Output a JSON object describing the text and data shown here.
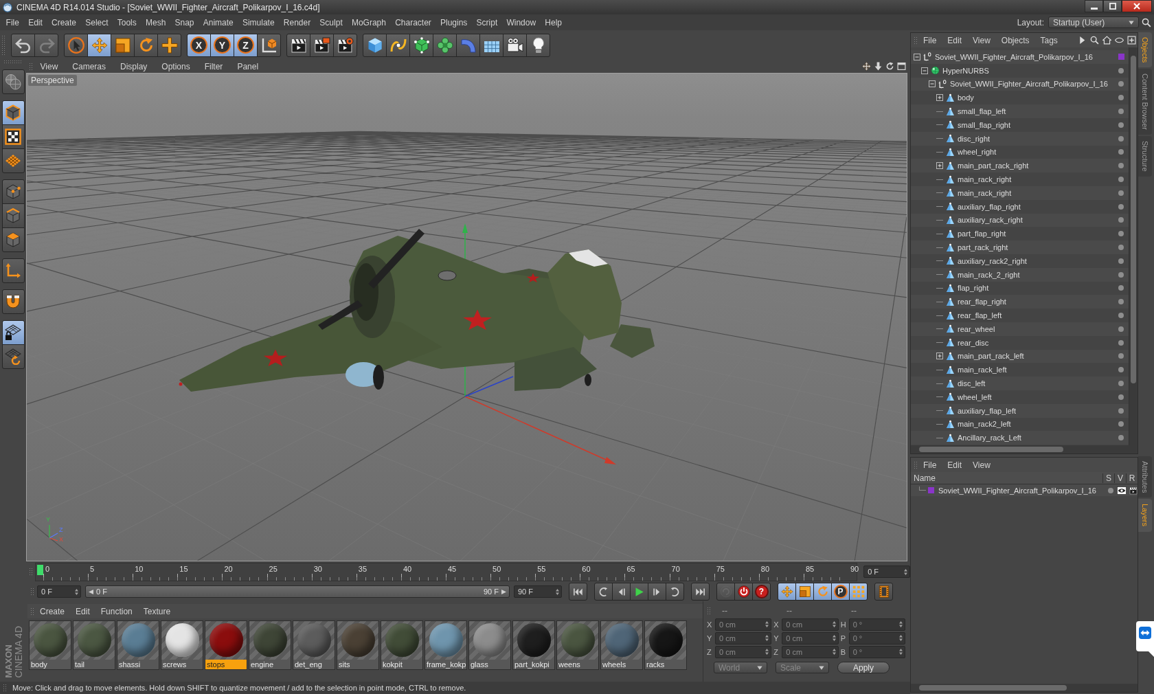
{
  "window": {
    "title": "CINEMA 4D R14.014 Studio - [Soviet_WWII_Fighter_Aircraft_Polikarpov_I_16.c4d]"
  },
  "menu": [
    "File",
    "Edit",
    "Create",
    "Select",
    "Tools",
    "Mesh",
    "Snap",
    "Animate",
    "Simulate",
    "Render",
    "Sculpt",
    "MoGraph",
    "Character",
    "Plugins",
    "Script",
    "Window",
    "Help"
  ],
  "layout": {
    "label": "Layout:",
    "value": "Startup (User)"
  },
  "toolbar": [
    [
      {
        "kind": "undo",
        "disabled": false
      },
      {
        "kind": "redo",
        "disabled": true
      }
    ],
    [
      {
        "kind": "select",
        "selected": false
      },
      {
        "kind": "move",
        "selected": true
      },
      {
        "kind": "scale",
        "selected": false
      },
      {
        "kind": "rotate",
        "selected": false
      },
      {
        "kind": "recent-tool",
        "selected": false
      }
    ],
    [
      {
        "kind": "axis-lock",
        "label": "X",
        "selected": true
      },
      {
        "kind": "axis-lock",
        "label": "Y",
        "selected": true
      },
      {
        "kind": "axis-lock",
        "label": "Z",
        "selected": true
      },
      {
        "kind": "coordinate-system",
        "selected": false
      }
    ],
    [
      {
        "kind": "render-view"
      },
      {
        "kind": "render-picture"
      },
      {
        "kind": "render-settings"
      }
    ],
    [
      {
        "kind": "cube"
      },
      {
        "kind": "spline"
      },
      {
        "kind": "nurbs"
      },
      {
        "kind": "cloner"
      },
      {
        "kind": "deformer"
      },
      {
        "kind": "floor"
      },
      {
        "kind": "camera"
      },
      {
        "kind": "light"
      }
    ]
  ],
  "left_tools": [
    [
      {
        "kind": "convert",
        "selected": false
      }
    ],
    [
      {
        "kind": "model",
        "selected": true
      },
      {
        "kind": "texture",
        "selected": false
      },
      {
        "kind": "workplane",
        "selected": false
      }
    ],
    [
      {
        "kind": "points",
        "selected": false
      },
      {
        "kind": "edges",
        "selected": false
      },
      {
        "kind": "polygons",
        "selected": false
      }
    ],
    [
      {
        "kind": "axis",
        "selected": false
      }
    ],
    [
      {
        "kind": "magnet",
        "selected": false
      }
    ],
    [
      {
        "kind": "lock-workplane",
        "selected": true
      },
      {
        "kind": "workplane-rotate",
        "selected": false
      }
    ]
  ],
  "viewport": {
    "menu": [
      "View",
      "Cameras",
      "Display",
      "Options",
      "Filter",
      "Panel"
    ],
    "name": "Perspective",
    "axis_labels": [
      "Y",
      "Z",
      "X"
    ]
  },
  "timeline": {
    "ticks": [
      "0",
      "5",
      "10",
      "15",
      "20",
      "25",
      "30",
      "35",
      "40",
      "45",
      "50",
      "55",
      "60",
      "65",
      "70",
      "75",
      "80",
      "85",
      "90"
    ],
    "level": 0,
    "current": "0 F"
  },
  "playback": {
    "start": "0 F",
    "range": {
      "start": "0 F",
      "end": "90 F",
      "level": 1
    },
    "end": "90 F",
    "transport": [
      [
        {
          "kind": "go-to-start"
        }
      ],
      [
        {
          "kind": "previous-key"
        },
        {
          "kind": "previous-frame"
        },
        {
          "kind": "play"
        },
        {
          "kind": "next-frame"
        },
        {
          "kind": "next-key"
        }
      ],
      [
        {
          "kind": "go-to-end"
        }
      ]
    ],
    "record": [
      {
        "kind": "autokey",
        "disabled": true
      },
      {
        "kind": "record",
        "disabled": false
      },
      {
        "kind": "key-selection",
        "label": "?",
        "disabled": false
      }
    ],
    "key_modes": [
      {
        "kind": "key-position",
        "selected": true
      },
      {
        "kind": "key-scale",
        "selected": true
      },
      {
        "kind": "key-rotation",
        "selected": true
      },
      {
        "kind": "key-parameter",
        "label": "P",
        "selected": true
      },
      {
        "kind": "key-pla",
        "selected": true
      }
    ]
  },
  "materials": {
    "menu": [
      "Create",
      "Edit",
      "Function",
      "Texture"
    ],
    "items": [
      {
        "name": "body",
        "color": "#4a5540",
        "selected": false
      },
      {
        "name": "tail",
        "color": "#4b5742",
        "selected": false
      },
      {
        "name": "shassi",
        "color": "#5a7d94",
        "selected": false
      },
      {
        "name": "screws",
        "color": "#e4e4e4",
        "selected": false
      },
      {
        "name": "stops",
        "color": "#8b0d0d",
        "selected": true
      },
      {
        "name": "engine",
        "color": "#3e4536",
        "selected": false
      },
      {
        "name": "det_eng",
        "color": "#5c5c5c",
        "selected": false
      },
      {
        "name": "sits",
        "color": "#4a4034",
        "selected": false
      },
      {
        "name": "kokpit",
        "color": "#414c37",
        "selected": false
      },
      {
        "name": "frame_kokp",
        "color": "#6f95ad",
        "selected": false
      },
      {
        "name": "glass",
        "color": "#8c8c8c",
        "selected": false
      },
      {
        "name": "part_kokpi",
        "color": "#1e1e1e",
        "selected": false
      },
      {
        "name": "weens",
        "color": "#4a5540",
        "selected": false
      },
      {
        "name": "wheels",
        "color": "#4f6577",
        "selected": false
      },
      {
        "name": "racks",
        "color": "#161616",
        "selected": false
      }
    ]
  },
  "coordinates": {
    "headers": [
      "--",
      "--",
      "--"
    ],
    "rows": [
      {
        "pos_axis": "X",
        "pos": "0 cm",
        "size_axis": "X",
        "size": "0 cm",
        "rot_axis": "H",
        "rot": "0 °"
      },
      {
        "pos_axis": "Y",
        "pos": "0 cm",
        "size_axis": "Y",
        "size": "0 cm",
        "rot_axis": "P",
        "rot": "0 °"
      },
      {
        "pos_axis": "Z",
        "pos": "0 cm",
        "size_axis": "Z",
        "size": "0 cm",
        "rot_axis": "B",
        "rot": "0 °"
      }
    ],
    "space": {
      "value": "World",
      "disabled": true
    },
    "mode": {
      "value": "Scale",
      "disabled": true
    },
    "apply": "Apply"
  },
  "brand": {
    "maker": "MAXON",
    "product": "CINEMA 4D"
  },
  "status_bar": "Move: Click and drag to move elements. Hold down SHIFT to quantize movement / add to the selection in point mode, CTRL to remove.",
  "objects": {
    "menu": [
      "File",
      "Edit",
      "View",
      "Objects",
      "Tags"
    ],
    "tree": [
      {
        "name": "Soviet_WWII_Fighter_Aircraft_Polikarpov_I_16",
        "kind": "null",
        "expanded": true,
        "color": "#8a35c9",
        "children": [
          {
            "name": "HyperNURBS",
            "kind": "nurbs",
            "expanded": true,
            "children": [
              {
                "name": "Soviet_WWII_Fighter_Aircraft_Polikarpov_I_16",
                "kind": "null",
                "expanded": true,
                "children": [
                  {
                    "name": "body",
                    "kind": "polygon",
                    "expanded": false
                  },
                  {
                    "name": "small_flap_left",
                    "kind": "polygon"
                  },
                  {
                    "name": "small_flap_right",
                    "kind": "polygon"
                  },
                  {
                    "name": "disc_right",
                    "kind": "polygon"
                  },
                  {
                    "name": "wheel_right",
                    "kind": "polygon"
                  },
                  {
                    "name": "main_part_rack_right",
                    "kind": "polygon",
                    "expanded": false
                  },
                  {
                    "name": "main_rack_right",
                    "kind": "polygon"
                  },
                  {
                    "name": "main_rack_right",
                    "kind": "polygon"
                  },
                  {
                    "name": "auxiliary_flap_right",
                    "kind": "polygon"
                  },
                  {
                    "name": "auxiliary_rack_right",
                    "kind": "polygon"
                  },
                  {
                    "name": "part_flap_right",
                    "kind": "polygon"
                  },
                  {
                    "name": "part_rack_right",
                    "kind": "polygon"
                  },
                  {
                    "name": "auxiliary_rack2_right",
                    "kind": "polygon"
                  },
                  {
                    "name": "main_rack_2_right",
                    "kind": "polygon"
                  },
                  {
                    "name": "flap_right",
                    "kind": "polygon"
                  },
                  {
                    "name": "rear_flap_right",
                    "kind": "polygon"
                  },
                  {
                    "name": "rear_flap_left",
                    "kind": "polygon"
                  },
                  {
                    "name": "rear_wheel",
                    "kind": "polygon"
                  },
                  {
                    "name": "rear_disc",
                    "kind": "polygon"
                  },
                  {
                    "name": "main_part_rack_left",
                    "kind": "polygon",
                    "expanded": false
                  },
                  {
                    "name": "main_rack_left",
                    "kind": "polygon"
                  },
                  {
                    "name": "disc_left",
                    "kind": "polygon"
                  },
                  {
                    "name": "wheel_left",
                    "kind": "polygon"
                  },
                  {
                    "name": "auxiliary_flap_left",
                    "kind": "polygon"
                  },
                  {
                    "name": "main_rack2_left",
                    "kind": "polygon"
                  },
                  {
                    "name": "Ancillary_rack_Left",
                    "kind": "polygon"
                  }
                ]
              }
            ]
          }
        ]
      }
    ]
  },
  "layers": {
    "menu": [
      "File",
      "Edit",
      "View"
    ],
    "columns": [
      "Name",
      "S",
      "V",
      "R"
    ],
    "rows": [
      {
        "name": "Soviet_WWII_Fighter_Aircraft_Polikarpov_I_16",
        "color": "#8a35c9"
      }
    ]
  },
  "side_tabs": {
    "top": [
      {
        "label": "Objects",
        "selected": true
      },
      {
        "label": "Content Browser",
        "selected": false
      },
      {
        "label": "Structure",
        "selected": false
      }
    ],
    "bottom": [
      {
        "label": "Attributes",
        "selected": false
      },
      {
        "label": "Layers",
        "selected": true
      }
    ]
  }
}
